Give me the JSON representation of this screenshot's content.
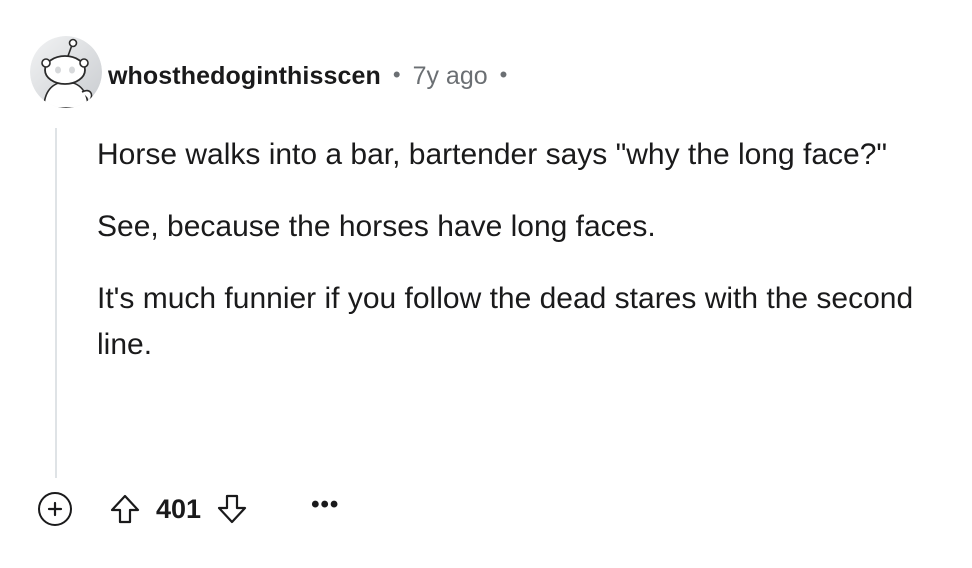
{
  "comment": {
    "author": "whosthedoginthisscen",
    "separator": "•",
    "timestamp": "7y ago",
    "paragraphs": [
      "Horse walks into a bar, bartender says \"why the long face?\"",
      "See, because the horses have long faces.",
      "It's much funnier if you follow the dead stares with the second line."
    ],
    "score": "401",
    "more_label": "•••"
  },
  "icons": {
    "avatar": "snoo-avatar",
    "expand": "plus-circle-icon",
    "upvote": "arrow-up-icon",
    "downvote": "arrow-down-icon",
    "more": "ellipsis-icon"
  },
  "colors": {
    "text": "#1a1a1b",
    "meta_text": "#6b6f73",
    "thread_line": "#dfe3e6",
    "background": "#ffffff"
  }
}
